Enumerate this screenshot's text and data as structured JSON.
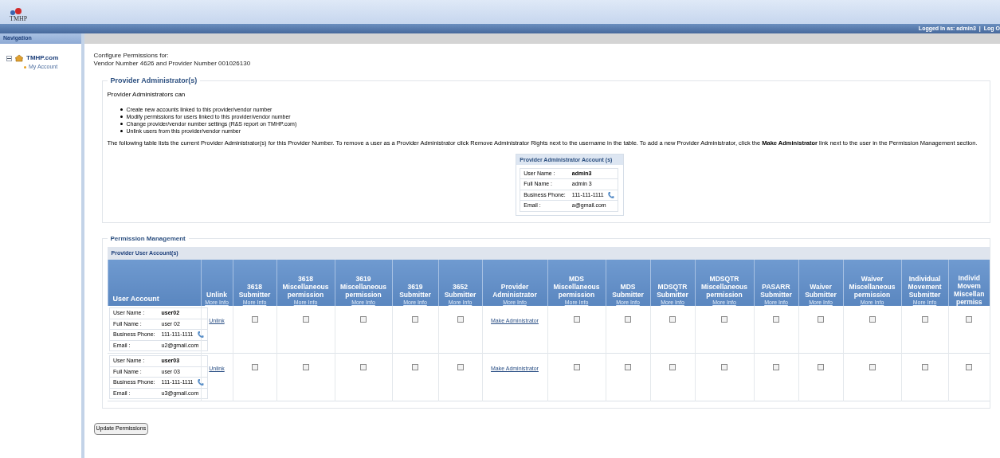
{
  "header": {
    "logo_text": "TMHP",
    "login_text": "Logged in as: admin3",
    "separator": "|",
    "logout": "Log O"
  },
  "nav": {
    "title": "Navigation",
    "tree": [
      {
        "label": "TMHP.com",
        "expanded": true,
        "children": [
          {
            "label": "My Account"
          }
        ]
      }
    ]
  },
  "page": {
    "heading": [
      "Configure Permissions for:",
      "Vendor Number 4626 and Provider Number 001026130"
    ]
  },
  "provider_admins": {
    "legend": "Provider Administrator(s)",
    "intro": "Provider Administrators can",
    "bullets": [
      "Create new accounts linked to this provider/vendor number",
      "Modify permissions for users linked to this provider/vendor number",
      "Change provider/vendor number settings (R&S report on TMHP.com)",
      "Unlink users from this provider/vendor number"
    ],
    "paragraph": "The following table lists the current Provider Administrator(s) for this Provider Number. To remove a user as a Provider Administrator click Remove Administrator Rights next to the username in the table. To add a new Provider Administrator, click the **Make Administrator** link next to the user in the Permission Management section.",
    "card": {
      "title": "Provider Administrator Account (s)",
      "fields": [
        {
          "label": "User Name :",
          "value": "admin3",
          "kind": "bold"
        },
        {
          "label": "Full Name :",
          "value": "admin 3",
          "kind": "text"
        },
        {
          "label": "Business Phone:",
          "value": "111-111-1111",
          "kind": "phone"
        },
        {
          "label": "Email :",
          "value": "a@gmail.com",
          "kind": "text"
        }
      ]
    }
  },
  "permission_management": {
    "legend": "Permission Management",
    "table_title": "Provider User Account(s)",
    "columns": [
      {
        "label": "User Account"
      },
      {
        "label": "Unlink",
        "more_info": "More Info"
      },
      {
        "label": "3618 Submitter",
        "more_info": "More Info"
      },
      {
        "label": "3618 Miscellaneous permission",
        "more_info": "More Info"
      },
      {
        "label": "3619 Miscellaneous permission",
        "more_info": "More Info"
      },
      {
        "label": "3619 Submitter",
        "more_info": "More Info"
      },
      {
        "label": "3652 Submitter",
        "more_info": "More Info"
      },
      {
        "label": "Provider Administrator",
        "more_info": "More Info"
      },
      {
        "label": "MDS Miscellaneous permission",
        "more_info": "More Info"
      },
      {
        "label": "MDS Submitter",
        "more_info": "More Info"
      },
      {
        "label": "MDSQTR Submitter",
        "more_info": "More Info"
      },
      {
        "label": "MDSQTR Miscellaneous permission",
        "more_info": "More Info"
      },
      {
        "label": "PASARR Submitter",
        "more_info": "More Info"
      },
      {
        "label": "Waiver Submitter",
        "more_info": "More Info"
      },
      {
        "label": "Waiver Miscellaneous permission",
        "more_info": "More Info"
      },
      {
        "label": "Individual Movement Submitter",
        "more_info": "More Info"
      },
      {
        "label": "Individ Movem Miscellan permiss"
      }
    ],
    "rows": [
      {
        "fields": [
          {
            "label": "User Name :",
            "value": "user02",
            "kind": "bold"
          },
          {
            "label": "Full Name :",
            "value": "user 02",
            "kind": "text"
          },
          {
            "label": "Business Phone:",
            "value": "111-111-1111",
            "kind": "phone"
          },
          {
            "label": "Email :",
            "value": "u2@gmail.com",
            "kind": "text"
          }
        ],
        "unlink": "Unlink",
        "cells": [
          {
            "kind": "checkbox",
            "checked": false
          },
          {
            "kind": "checkbox",
            "checked": false
          },
          {
            "kind": "checkbox",
            "checked": false
          },
          {
            "kind": "checkbox",
            "checked": false
          },
          {
            "kind": "checkbox",
            "checked": false
          },
          {
            "kind": "link",
            "text": "Make Administrator"
          },
          {
            "kind": "checkbox",
            "checked": false
          },
          {
            "kind": "checkbox",
            "checked": false
          },
          {
            "kind": "checkbox",
            "checked": false
          },
          {
            "kind": "checkbox",
            "checked": false
          },
          {
            "kind": "checkbox",
            "checked": false
          },
          {
            "kind": "checkbox",
            "checked": false
          },
          {
            "kind": "checkbox",
            "checked": false
          },
          {
            "kind": "checkbox",
            "checked": false
          },
          {
            "kind": "checkbox",
            "checked": false
          }
        ]
      },
      {
        "fields": [
          {
            "label": "User Name :",
            "value": "user03",
            "kind": "bold"
          },
          {
            "label": "Full Name :",
            "value": "user 03",
            "kind": "text"
          },
          {
            "label": "Business Phone:",
            "value": "111-111-1111",
            "kind": "phone"
          },
          {
            "label": "Email :",
            "value": "u3@gmail.com",
            "kind": "text"
          }
        ],
        "unlink": "Unlink",
        "cells": [
          {
            "kind": "checkbox",
            "checked": false
          },
          {
            "kind": "checkbox",
            "checked": false
          },
          {
            "kind": "checkbox",
            "checked": false
          },
          {
            "kind": "checkbox",
            "checked": false
          },
          {
            "kind": "checkbox",
            "checked": false
          },
          {
            "kind": "link",
            "text": "Make Administrator"
          },
          {
            "kind": "checkbox",
            "checked": false
          },
          {
            "kind": "checkbox",
            "checked": false
          },
          {
            "kind": "checkbox",
            "checked": false
          },
          {
            "kind": "checkbox",
            "checked": false
          },
          {
            "kind": "checkbox",
            "checked": false
          },
          {
            "kind": "checkbox",
            "checked": false
          },
          {
            "kind": "checkbox",
            "checked": false
          },
          {
            "kind": "checkbox",
            "checked": false
          },
          {
            "kind": "checkbox",
            "checked": false
          }
        ]
      }
    ]
  },
  "update_button": "Update Permissions"
}
